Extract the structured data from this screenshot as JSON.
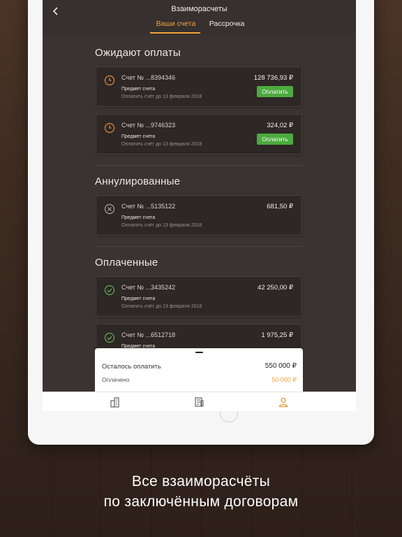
{
  "header": {
    "title": "Взаиморасчеты",
    "tabs": [
      {
        "label": "Ваши счета"
      },
      {
        "label": "Рассрочка"
      }
    ]
  },
  "sections": {
    "pending": {
      "title": "Ожидают оплаты"
    },
    "cancelled": {
      "title": "Аннулированные"
    },
    "paid": {
      "title": "Оплаченные"
    }
  },
  "invoices": [
    {
      "number": "Счет № ...8394346",
      "amount": "128 736,93 ₽",
      "subject": "Предмет счета",
      "due": "Оплатить счёт до 13 февраля 2018",
      "status": "pending",
      "action": "Оплатить"
    },
    {
      "number": "Счет № ...9746323",
      "amount": "324,02 ₽",
      "subject": "Предмет счета",
      "due": "Оплатить счёт до 13 февраля 2018",
      "status": "pending",
      "action": "Оплатить"
    },
    {
      "number": "Счет № ...5135122",
      "amount": "681,50 ₽",
      "subject": "Предмет счета",
      "due": "Оплатить счёт до 13 февраля 2018",
      "status": "cancelled"
    },
    {
      "number": "Счет № ...3435242",
      "amount": "42 250,00 ₽",
      "subject": "Предмет счета",
      "due": "Оплатить счёт до 13 февраля 2018",
      "status": "paid"
    },
    {
      "number": "Счет № ...6512718",
      "amount": "1 975,25 ₽",
      "subject": "Предмет счета",
      "status": "paid"
    }
  ],
  "summary": {
    "remaining_label": "Осталось оплатить",
    "remaining_value": "550 000 ₽",
    "paid_label": "Оплачено",
    "paid_value": "50 000 ₽"
  },
  "tabbar": {
    "items": [
      {
        "icon": "buildings-icon"
      },
      {
        "icon": "document-icon"
      },
      {
        "icon": "profile-icon"
      }
    ]
  },
  "caption": {
    "line1": "Все взаиморасчёты",
    "line2": "по заключённым договорам"
  },
  "colors": {
    "accent": "#f2a33a",
    "pay_button": "#4caa3e",
    "paid_icon": "#5bb04a",
    "screen_bg": "#3b3331"
  }
}
